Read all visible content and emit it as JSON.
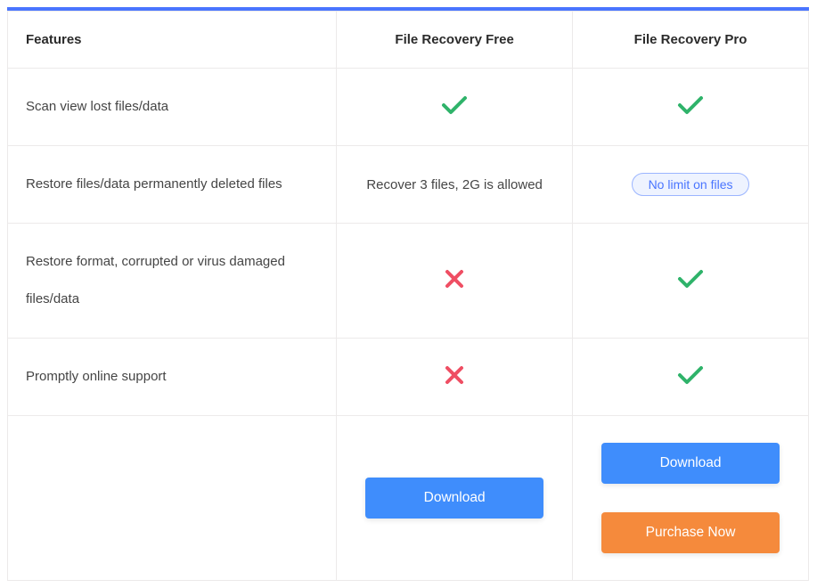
{
  "headers": {
    "features": "Features",
    "free": "File Recovery Free",
    "pro": "File Recovery Pro"
  },
  "rows": [
    {
      "feature": "Scan view lost files/data",
      "free": {
        "type": "check"
      },
      "pro": {
        "type": "check"
      }
    },
    {
      "feature": "Restore files/data permanently deleted files",
      "free": {
        "type": "text",
        "text": "Recover 3 files, 2G is allowed"
      },
      "pro": {
        "type": "badge",
        "text": "No limit on files"
      }
    },
    {
      "feature": "Restore format, corrupted or virus damaged files/data",
      "free": {
        "type": "cross"
      },
      "pro": {
        "type": "check"
      }
    },
    {
      "feature": "Promptly online support",
      "free": {
        "type": "cross"
      },
      "pro": {
        "type": "check"
      }
    }
  ],
  "buttons": {
    "free": {
      "download": "Download"
    },
    "pro": {
      "download": "Download",
      "purchase": "Purchase Now"
    }
  }
}
